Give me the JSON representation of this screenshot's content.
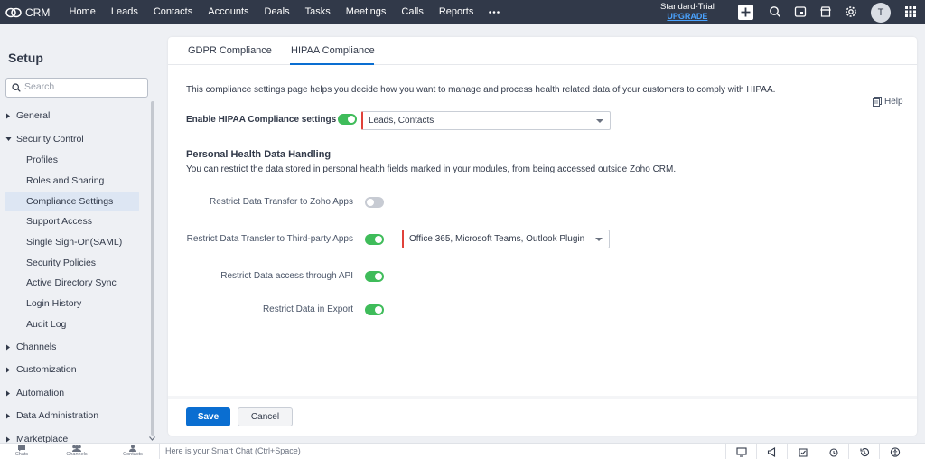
{
  "topnav": {
    "brand": "CRM",
    "items": [
      "Home",
      "Leads",
      "Contacts",
      "Accounts",
      "Deals",
      "Tasks",
      "Meetings",
      "Calls",
      "Reports"
    ],
    "trial_label": "Standard-Trial",
    "upgrade_label": "UPGRADE",
    "avatar_initial": "T"
  },
  "sidebar": {
    "title": "Setup",
    "search_placeholder": "Search",
    "groups": {
      "general": "General",
      "security": "Security Control",
      "channels": "Channels",
      "customization": "Customization",
      "automation": "Automation",
      "data_admin": "Data Administration",
      "marketplace": "Marketplace"
    },
    "security_items": [
      "Profiles",
      "Roles and Sharing",
      "Compliance Settings",
      "Support Access",
      "Single Sign-On(SAML)",
      "Security Policies",
      "Active Directory Sync",
      "Login History",
      "Audit Log"
    ]
  },
  "tabs": [
    "GDPR Compliance",
    "HIPAA Compliance"
  ],
  "main": {
    "description": "This compliance settings page helps you decide how you want to manage and process health related data of your customers to comply with HIPAA.",
    "help_label": "Help",
    "enable_label": "Enable HIPAA Compliance settings",
    "enable_on": true,
    "modules_value": "Leads, Contacts",
    "section_title": "Personal Health Data Handling",
    "section_desc": "You can restrict the data stored in personal health fields marked in your modules, from being accessed outside Zoho CRM.",
    "rows": [
      {
        "label": "Restrict Data Transfer to Zoho Apps",
        "on": false
      },
      {
        "label": "Restrict Data Transfer to Third-party Apps",
        "on": true,
        "select": "Office 365, Microsoft Teams, Outlook Plugin"
      },
      {
        "label": "Restrict Data access through API",
        "on": true
      },
      {
        "label": "Restrict Data in Export",
        "on": true
      }
    ],
    "save_label": "Save",
    "cancel_label": "Cancel"
  },
  "bottombar": {
    "items": [
      "Chats",
      "Channels",
      "Contacts"
    ],
    "smartchat_placeholder": "Here is your Smart Chat (Ctrl+Space)"
  },
  "colors": {
    "nav_bg": "#313949",
    "accent": "#0a6ed1",
    "toggle_on": "#3fbc5a",
    "required_marker": "#e0413a"
  }
}
